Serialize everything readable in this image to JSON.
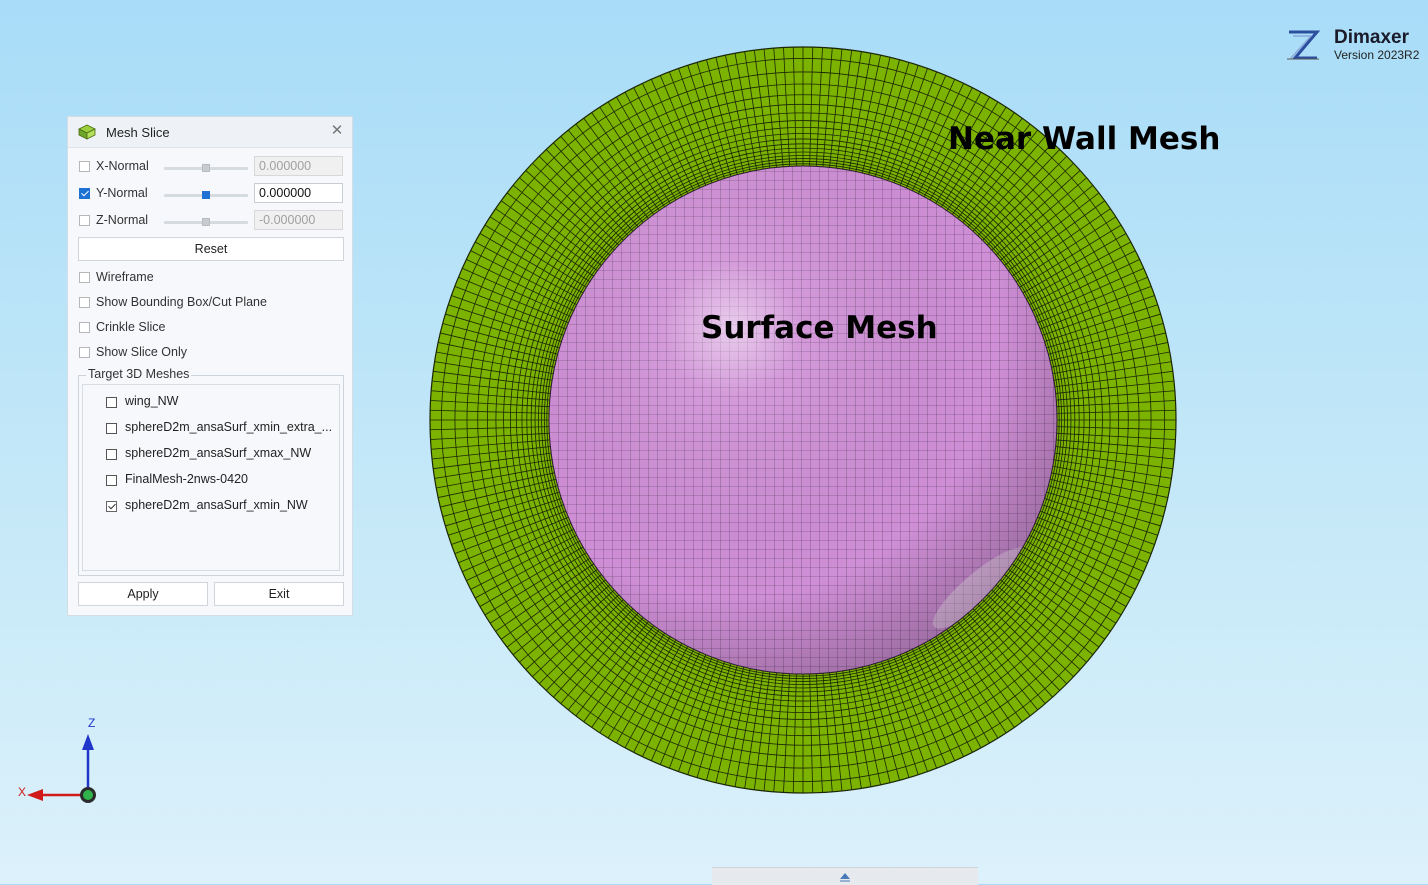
{
  "app": {
    "name": "Dimaxer",
    "version": "Version 2023R2"
  },
  "annotations": {
    "near_wall": "Near Wall Mesh",
    "surface": "Surface Mesh"
  },
  "colors": {
    "near_wall_mesh": "#7bb300",
    "surface_mesh": "#cf8fd6",
    "accent": "#1d72d3"
  },
  "dialog": {
    "title": "Mesh Slice",
    "axes": [
      {
        "label": "X-Normal",
        "checked": false,
        "value": "0.000000",
        "enabled": false,
        "slider": 0.5
      },
      {
        "label": "Y-Normal",
        "checked": true,
        "value": "0.000000",
        "enabled": true,
        "slider": 0.5
      },
      {
        "label": "Z-Normal",
        "checked": false,
        "value": "-0.000000",
        "enabled": false,
        "slider": 0.5
      }
    ],
    "reset_label": "Reset",
    "options": [
      {
        "label": "Wireframe",
        "checked": false
      },
      {
        "label": "Show Bounding Box/Cut Plane",
        "checked": false
      },
      {
        "label": "Crinkle Slice",
        "checked": false
      },
      {
        "label": "Show Slice Only",
        "checked": false
      }
    ],
    "target_title": "Target 3D Meshes",
    "meshes": [
      {
        "label": "wing_NW",
        "checked": false
      },
      {
        "label": "sphereD2m_ansaSurf_xmin_extra_...",
        "checked": false
      },
      {
        "label": "sphereD2m_ansaSurf_xmax_NW",
        "checked": false
      },
      {
        "label": "FinalMesh-2nws-0420",
        "checked": false
      },
      {
        "label": "sphereD2m_ansaSurf_xmin_NW",
        "checked": true
      }
    ],
    "apply_label": "Apply",
    "exit_label": "Exit"
  },
  "triad": {
    "z_label": "Z",
    "x_label": "X"
  }
}
